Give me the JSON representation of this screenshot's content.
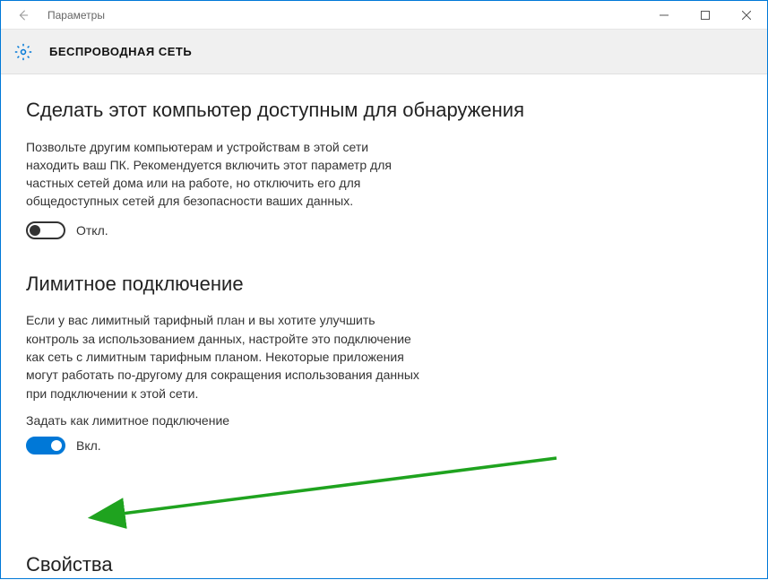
{
  "titlebar": {
    "app_title": "Параметры"
  },
  "header": {
    "title": "БЕСПРОВОДНАЯ СЕТЬ"
  },
  "section1": {
    "heading": "Сделать этот компьютер доступным для обнаружения",
    "desc": "Позвольте другим компьютерам и устройствам в этой сети находить ваш ПК. Рекомендуется включить этот параметр для частных сетей дома или на работе, но отключить его для общедоступных сетей для безопасности ваших данных.",
    "toggle_label": "Откл."
  },
  "section2": {
    "heading": "Лимитное подключение",
    "desc": "Если у вас лимитный тарифный план и вы хотите улучшить контроль за использованием данных, настройте это подключение как сеть с лимитным тарифным планом. Некоторые приложения могут работать по-другому для сокращения использования данных при подключении к этой сети.",
    "sub_label": "Задать как лимитное подключение",
    "toggle_label": "Вкл."
  },
  "section3": {
    "heading": "Свойства"
  }
}
